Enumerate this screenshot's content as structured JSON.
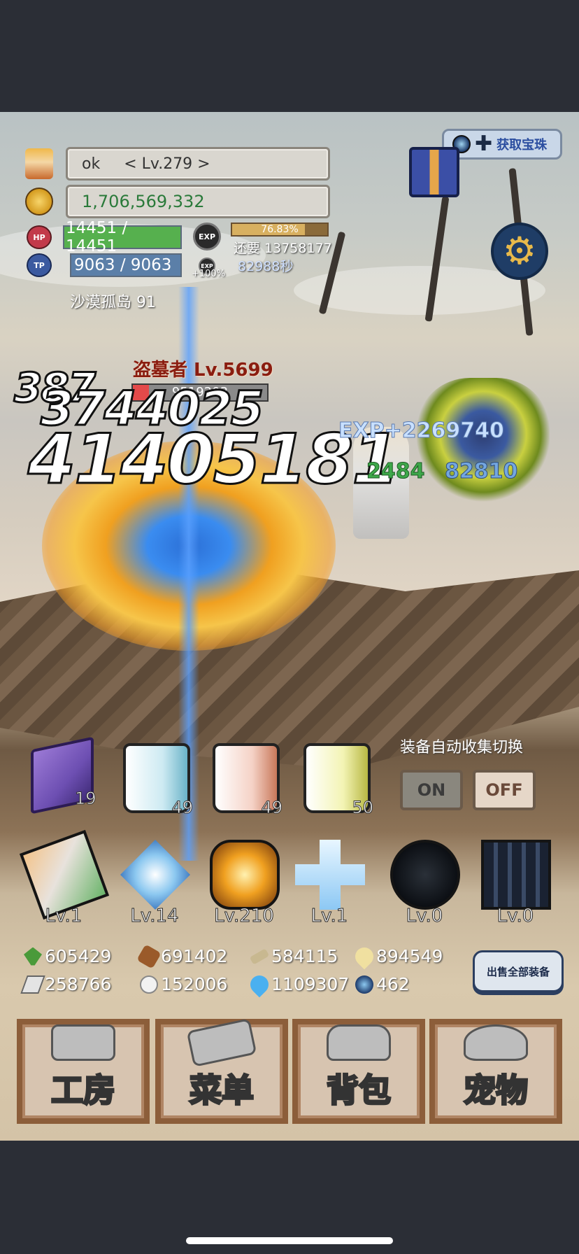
{
  "player": {
    "name": "ok",
    "level": "< Lv.279 >",
    "gold": "1,706,569,332",
    "hp": "14451 / 14451",
    "tp": "9063 / 9063",
    "hp_label": "HP",
    "tp_label": "TP",
    "exp_label": "EXP",
    "exp_bonus": "+100%",
    "exp_percent": "76.83%",
    "exp_fraction": 0.7683,
    "exp_remaining": "还要 13758177",
    "timer": "82988秒",
    "location": "沙漠孤岛 91"
  },
  "top_right": {
    "get_label": "获取宝珠"
  },
  "battle": {
    "enemy_name": "盗墓者 Lv.5699",
    "enemy_hp": "9519203",
    "enemy_hp_fraction": 0.12,
    "damage_big": "41405181",
    "damage_mid": "3744025",
    "damage_small": "387",
    "exp_gain": "EXP+2269740",
    "heal_a": "2484",
    "heal_b": "82810"
  },
  "auto_collect": {
    "label": "装备自动收集切换",
    "on_label": "ON",
    "off_label": "OFF"
  },
  "items": [
    {
      "icon": "spellbook-icon",
      "count": "19"
    },
    {
      "icon": "blue-potion-icon",
      "count": "49"
    },
    {
      "icon": "red-potion-icon",
      "count": "49"
    },
    {
      "icon": "yellow-potion-icon",
      "count": "50"
    }
  ],
  "equipment": [
    {
      "icon": "sword-icon",
      "level": "Lv.1"
    },
    {
      "icon": "crystal-icon",
      "level": "Lv.14"
    },
    {
      "icon": "fire-orb-icon",
      "level": "Lv.210"
    },
    {
      "icon": "cross-icon",
      "level": "Lv.1"
    },
    {
      "icon": "dark-orb-icon",
      "level": "Lv.0"
    },
    {
      "icon": "shadow-icon",
      "level": "Lv.0"
    }
  ],
  "resources": [
    {
      "icon": "herb-icon",
      "value": "605429"
    },
    {
      "icon": "wood-icon",
      "value": "691402"
    },
    {
      "icon": "bone-icon",
      "value": "584115"
    },
    {
      "icon": "drop-icon",
      "value": "894549"
    },
    {
      "icon": "iron-icon",
      "value": "258766"
    },
    {
      "icon": "stone-icon",
      "value": "152006"
    },
    {
      "icon": "flame-icon",
      "value": "1109307"
    },
    {
      "icon": "orb-icon",
      "value": "462"
    }
  ],
  "sell_all_label": "出售全部装备",
  "menu": [
    {
      "icon": "workshop-icon",
      "label": "工房"
    },
    {
      "icon": "menu-book-icon",
      "label": "菜单"
    },
    {
      "icon": "backpack-icon",
      "label": "背包"
    },
    {
      "icon": "pet-icon",
      "label": "宠物"
    }
  ],
  "colors": {
    "hp_bar": "#56b04e",
    "tp_bar": "#5b7fa8",
    "enemy_name": "#8a1d10",
    "menu_border": "#8c5e3a"
  }
}
